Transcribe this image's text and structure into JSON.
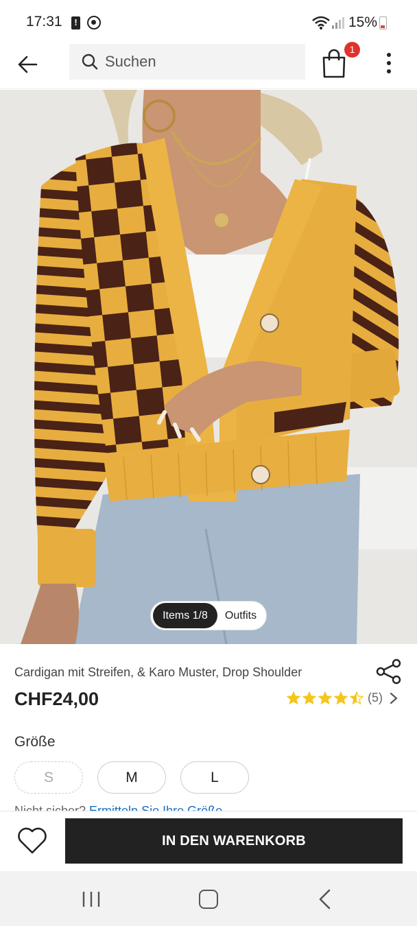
{
  "status_bar": {
    "time": "17:31",
    "battery_percent": "15%",
    "icons": [
      "alert-icon",
      "sync-icon",
      "wifi-icon",
      "signal-icon",
      "battery-icon"
    ]
  },
  "header": {
    "back_icon": "arrow-left-icon",
    "search_placeholder": "Suchen",
    "search_icon": "search-icon",
    "cart_icon": "shopping-bag-icon",
    "cart_badge": "1",
    "more_icon": "more-vertical-icon"
  },
  "gallery": {
    "toggle_items_label": "Items 1/8",
    "toggle_outfits_label": "Outfits"
  },
  "product": {
    "title": "Cardigan mit Streifen, & Karo Muster, Drop Shoulder",
    "price": "CHF24,00",
    "rating": 4.5,
    "review_count": "(5)",
    "share_icon": "share-icon"
  },
  "sizes": {
    "label": "Größe",
    "options": [
      {
        "label": "S",
        "available": false
      },
      {
        "label": "M",
        "available": true
      },
      {
        "label": "L",
        "available": true
      }
    ],
    "hint_text": "Nicht sicher? ",
    "hint_link": "Ermitteln Sie Ihre Größe"
  },
  "actions": {
    "wishlist_icon": "heart-icon",
    "add_to_cart_label": "IN DEN WARENKORB"
  },
  "colors": {
    "accent_dark": "#222222",
    "badge_red": "#e0322b",
    "star_yellow": "#f5c518",
    "link_blue": "#1a6bc4",
    "cardigan_mustard": "#e7ae3f",
    "cardigan_brown": "#4a2216"
  }
}
